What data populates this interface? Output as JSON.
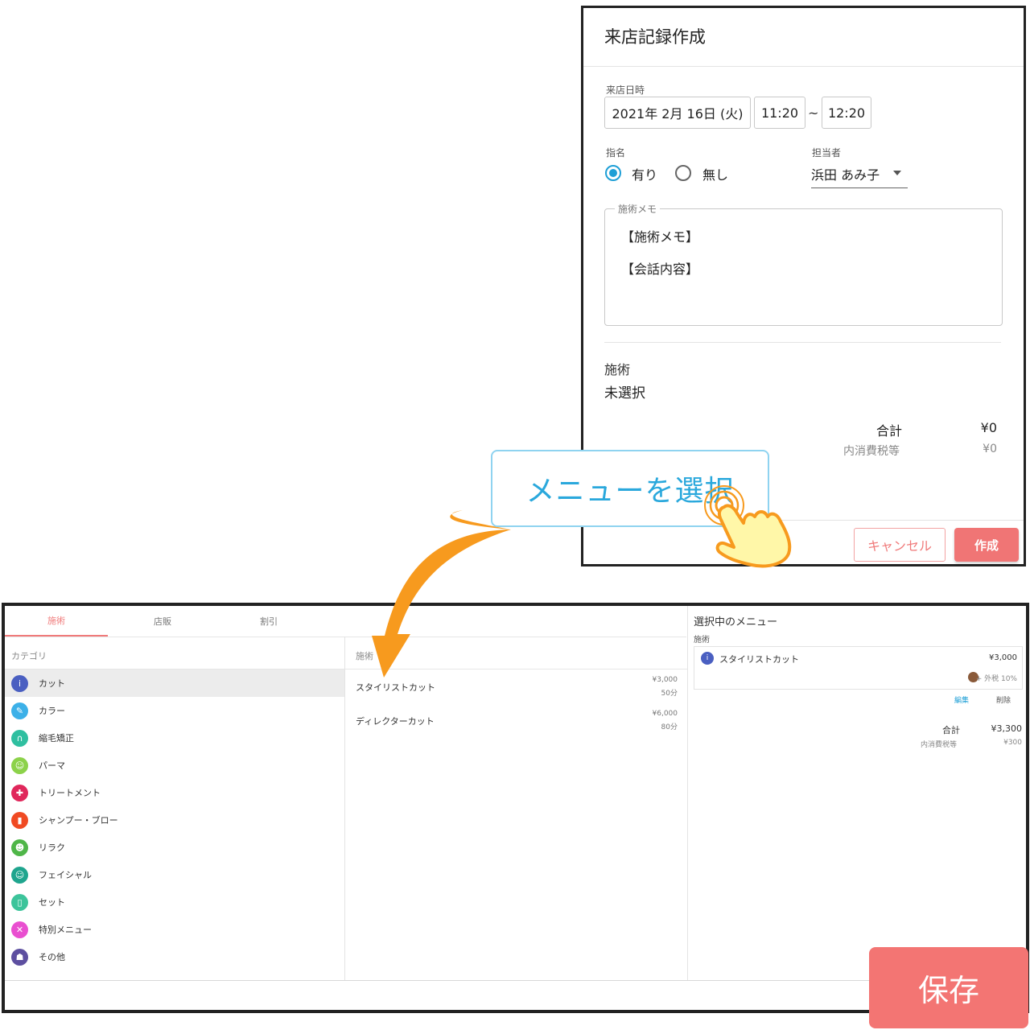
{
  "dialog": {
    "title": "来店記録作成",
    "visit_label": "来店日時",
    "date": "2021年 2月 16日 (火)",
    "start_time": "11:20",
    "tilde": "~",
    "end_time": "12:20",
    "nomination_label": "指名",
    "nomination_options": [
      "有り",
      "無し"
    ],
    "staff_label": "担当者",
    "staff_value": "浜田 あみ子",
    "memo_label": "施術メモ",
    "memo_lines": [
      "【施術メモ】",
      "【会話内容】"
    ],
    "treatment_label": "施術",
    "treatment_value": "未選択",
    "total_label": "合計",
    "total_value": "¥0",
    "tax_label": "内消費税等",
    "tax_value": "¥0",
    "cancel_label": "キャンセル",
    "create_label": "作成"
  },
  "callout": {
    "text": "メニューを選択"
  },
  "panel": {
    "tabs": [
      "施術",
      "店販",
      "割引"
    ],
    "category_header": "カテゴリ",
    "menu_header": "施術",
    "categories": [
      {
        "label": "カット",
        "color": "#4a5fc1",
        "glyph": "i"
      },
      {
        "label": "カラー",
        "color": "#3cb0e8",
        "glyph": "✎"
      },
      {
        "label": "縮毛矯正",
        "color": "#2fbfa0",
        "glyph": "∩"
      },
      {
        "label": "パーマ",
        "color": "#8cd24a",
        "glyph": "☺"
      },
      {
        "label": "トリートメント",
        "color": "#e0275b",
        "glyph": "✚"
      },
      {
        "label": "シャンプー・ブロー",
        "color": "#f04a23",
        "glyph": "▮"
      },
      {
        "label": "リラク",
        "color": "#4fb648",
        "glyph": "☻"
      },
      {
        "label": "フェイシャル",
        "color": "#1fa58e",
        "glyph": "☺"
      },
      {
        "label": "セット",
        "color": "#3dc49b",
        "glyph": "▯"
      },
      {
        "label": "特別メニュー",
        "color": "#e94fd0",
        "glyph": "✕"
      },
      {
        "label": "その他",
        "color": "#5d4fa0",
        "glyph": "☗"
      }
    ],
    "menus": [
      {
        "name": "スタイリストカット",
        "price": "¥3,000",
        "duration": "50分"
      },
      {
        "name": "ディレクターカット",
        "price": "¥6,000",
        "duration": "80分"
      }
    ],
    "selected_title": "選択中のメニュー",
    "selected_section": "施術",
    "selected_item": {
      "name": "スタイリストカット",
      "price": "¥3,000",
      "tax_note": "+ 外税 10%"
    },
    "edit_label": "編集",
    "delete_label": "削除",
    "total_label": "合計",
    "total_value": "¥3,300",
    "tax_label": "内消費税等",
    "tax_value": "¥300",
    "save_label": "保存"
  },
  "colors": {
    "accent_red": "#f07575",
    "accent_blue": "#1e9fd6",
    "arrow_orange": "#f79a1e"
  }
}
